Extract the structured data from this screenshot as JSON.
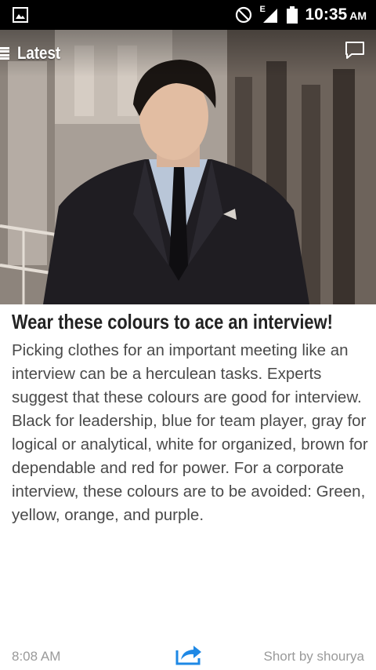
{
  "status_bar": {
    "time": "10:35",
    "ampm": "AM",
    "network_label": "E",
    "icons": [
      "image-notification-icon",
      "do-not-disturb-icon",
      "signal-icon",
      "battery-icon"
    ]
  },
  "nav": {
    "label": "Latest",
    "menu_icon": "hamburger-icon",
    "comment_icon": "comment-icon"
  },
  "hero": {
    "image": "man-in-dark-suit-photo"
  },
  "article": {
    "title": "Wear these colours to ace an interview!",
    "body": "Picking clothes for an important meeting like an interview can be a herculean tasks. Experts suggest that these colours are good for interview. Black for leadership, blue for team player, gray for logical or analytical, white for organized, brown for dependable and red for power. For a corporate interview, these colours are to be avoided: Green, yellow, orange, and purple."
  },
  "footer": {
    "time": "8:08 AM",
    "author": "Short by shourya",
    "share_icon": "share-icon",
    "accent_color": "#1e88e5"
  }
}
